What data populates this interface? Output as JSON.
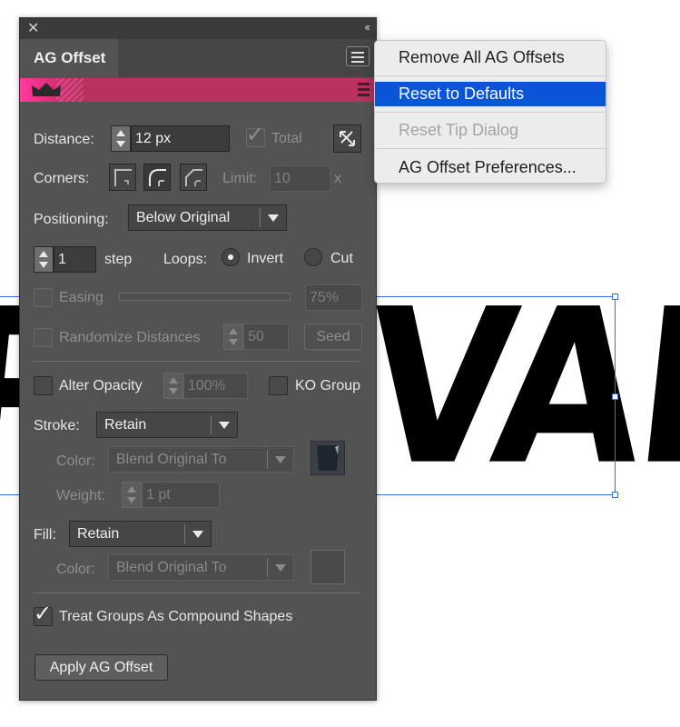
{
  "artwork": {
    "left_text": "P",
    "right_text": "VAL"
  },
  "panel": {
    "title": "AG Offset",
    "distance": {
      "label": "Distance:",
      "value": "12 px",
      "total_label": "Total",
      "total_checked": true
    },
    "corners": {
      "label": "Corners:",
      "limit_label": "Limit:",
      "limit_value": "10",
      "limit_unit": "x",
      "selected": "round"
    },
    "positioning": {
      "label": "Positioning:",
      "value": "Below Original"
    },
    "steps": {
      "value": "1",
      "unit_label": "step",
      "loops_label": "Loops:",
      "invert_label": "Invert",
      "cut_label": "Cut",
      "selected": "Invert"
    },
    "easing": {
      "label": "Easing",
      "value": "75%"
    },
    "randomize": {
      "label": "Randomize Distances",
      "value": "50",
      "seed_label": "Seed"
    },
    "opacity": {
      "label": "Alter Opacity",
      "value": "100%",
      "ko_label": "KO Group"
    },
    "stroke": {
      "label": "Stroke:",
      "value": "Retain",
      "color_label": "Color:",
      "color_value": "Blend Original To",
      "weight_label": "Weight:",
      "weight_value": "1 pt"
    },
    "fill": {
      "label": "Fill:",
      "value": "Retain",
      "color_label": "Color:",
      "color_value": "Blend Original To"
    },
    "treat_groups": {
      "label": "Treat Groups As Compound Shapes",
      "checked": true
    },
    "apply_label": "Apply AG Offset",
    "colors": {
      "panel_bg": "#535353",
      "banner": "#b8315f",
      "accent_pink": "#ff3aa0"
    }
  },
  "menu": {
    "items": [
      {
        "label": "Remove All AG Offsets",
        "state": "normal"
      },
      {
        "label": "Reset to Defaults",
        "state": "highlighted"
      },
      {
        "label": "Reset Tip Dialog",
        "state": "disabled"
      },
      {
        "label": "AG Offset Preferences...",
        "state": "normal"
      }
    ],
    "highlight_color": "#0a55d6"
  }
}
